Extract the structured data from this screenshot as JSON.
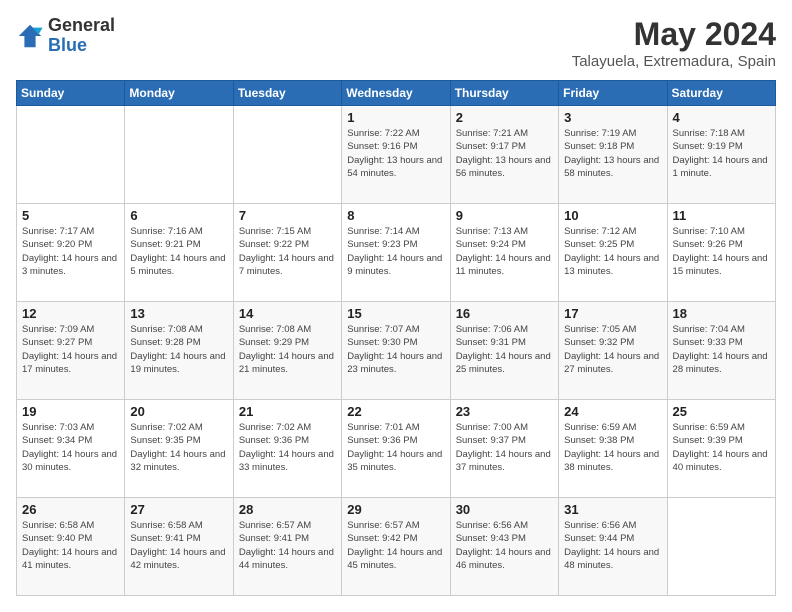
{
  "logo": {
    "general": "General",
    "blue": "Blue"
  },
  "header": {
    "title": "May 2024",
    "subtitle": "Talayuela, Extremadura, Spain"
  },
  "weekdays": [
    "Sunday",
    "Monday",
    "Tuesday",
    "Wednesday",
    "Thursday",
    "Friday",
    "Saturday"
  ],
  "weeks": [
    [
      {
        "day": "",
        "sunrise": "",
        "sunset": "",
        "daylight": ""
      },
      {
        "day": "",
        "sunrise": "",
        "sunset": "",
        "daylight": ""
      },
      {
        "day": "",
        "sunrise": "",
        "sunset": "",
        "daylight": ""
      },
      {
        "day": "1",
        "sunrise": "Sunrise: 7:22 AM",
        "sunset": "Sunset: 9:16 PM",
        "daylight": "Daylight: 13 hours and 54 minutes."
      },
      {
        "day": "2",
        "sunrise": "Sunrise: 7:21 AM",
        "sunset": "Sunset: 9:17 PM",
        "daylight": "Daylight: 13 hours and 56 minutes."
      },
      {
        "day": "3",
        "sunrise": "Sunrise: 7:19 AM",
        "sunset": "Sunset: 9:18 PM",
        "daylight": "Daylight: 13 hours and 58 minutes."
      },
      {
        "day": "4",
        "sunrise": "Sunrise: 7:18 AM",
        "sunset": "Sunset: 9:19 PM",
        "daylight": "Daylight: 14 hours and 1 minute."
      }
    ],
    [
      {
        "day": "5",
        "sunrise": "Sunrise: 7:17 AM",
        "sunset": "Sunset: 9:20 PM",
        "daylight": "Daylight: 14 hours and 3 minutes."
      },
      {
        "day": "6",
        "sunrise": "Sunrise: 7:16 AM",
        "sunset": "Sunset: 9:21 PM",
        "daylight": "Daylight: 14 hours and 5 minutes."
      },
      {
        "day": "7",
        "sunrise": "Sunrise: 7:15 AM",
        "sunset": "Sunset: 9:22 PM",
        "daylight": "Daylight: 14 hours and 7 minutes."
      },
      {
        "day": "8",
        "sunrise": "Sunrise: 7:14 AM",
        "sunset": "Sunset: 9:23 PM",
        "daylight": "Daylight: 14 hours and 9 minutes."
      },
      {
        "day": "9",
        "sunrise": "Sunrise: 7:13 AM",
        "sunset": "Sunset: 9:24 PM",
        "daylight": "Daylight: 14 hours and 11 minutes."
      },
      {
        "day": "10",
        "sunrise": "Sunrise: 7:12 AM",
        "sunset": "Sunset: 9:25 PM",
        "daylight": "Daylight: 14 hours and 13 minutes."
      },
      {
        "day": "11",
        "sunrise": "Sunrise: 7:10 AM",
        "sunset": "Sunset: 9:26 PM",
        "daylight": "Daylight: 14 hours and 15 minutes."
      }
    ],
    [
      {
        "day": "12",
        "sunrise": "Sunrise: 7:09 AM",
        "sunset": "Sunset: 9:27 PM",
        "daylight": "Daylight: 14 hours and 17 minutes."
      },
      {
        "day": "13",
        "sunrise": "Sunrise: 7:08 AM",
        "sunset": "Sunset: 9:28 PM",
        "daylight": "Daylight: 14 hours and 19 minutes."
      },
      {
        "day": "14",
        "sunrise": "Sunrise: 7:08 AM",
        "sunset": "Sunset: 9:29 PM",
        "daylight": "Daylight: 14 hours and 21 minutes."
      },
      {
        "day": "15",
        "sunrise": "Sunrise: 7:07 AM",
        "sunset": "Sunset: 9:30 PM",
        "daylight": "Daylight: 14 hours and 23 minutes."
      },
      {
        "day": "16",
        "sunrise": "Sunrise: 7:06 AM",
        "sunset": "Sunset: 9:31 PM",
        "daylight": "Daylight: 14 hours and 25 minutes."
      },
      {
        "day": "17",
        "sunrise": "Sunrise: 7:05 AM",
        "sunset": "Sunset: 9:32 PM",
        "daylight": "Daylight: 14 hours and 27 minutes."
      },
      {
        "day": "18",
        "sunrise": "Sunrise: 7:04 AM",
        "sunset": "Sunset: 9:33 PM",
        "daylight": "Daylight: 14 hours and 28 minutes."
      }
    ],
    [
      {
        "day": "19",
        "sunrise": "Sunrise: 7:03 AM",
        "sunset": "Sunset: 9:34 PM",
        "daylight": "Daylight: 14 hours and 30 minutes."
      },
      {
        "day": "20",
        "sunrise": "Sunrise: 7:02 AM",
        "sunset": "Sunset: 9:35 PM",
        "daylight": "Daylight: 14 hours and 32 minutes."
      },
      {
        "day": "21",
        "sunrise": "Sunrise: 7:02 AM",
        "sunset": "Sunset: 9:36 PM",
        "daylight": "Daylight: 14 hours and 33 minutes."
      },
      {
        "day": "22",
        "sunrise": "Sunrise: 7:01 AM",
        "sunset": "Sunset: 9:36 PM",
        "daylight": "Daylight: 14 hours and 35 minutes."
      },
      {
        "day": "23",
        "sunrise": "Sunrise: 7:00 AM",
        "sunset": "Sunset: 9:37 PM",
        "daylight": "Daylight: 14 hours and 37 minutes."
      },
      {
        "day": "24",
        "sunrise": "Sunrise: 6:59 AM",
        "sunset": "Sunset: 9:38 PM",
        "daylight": "Daylight: 14 hours and 38 minutes."
      },
      {
        "day": "25",
        "sunrise": "Sunrise: 6:59 AM",
        "sunset": "Sunset: 9:39 PM",
        "daylight": "Daylight: 14 hours and 40 minutes."
      }
    ],
    [
      {
        "day": "26",
        "sunrise": "Sunrise: 6:58 AM",
        "sunset": "Sunset: 9:40 PM",
        "daylight": "Daylight: 14 hours and 41 minutes."
      },
      {
        "day": "27",
        "sunrise": "Sunrise: 6:58 AM",
        "sunset": "Sunset: 9:41 PM",
        "daylight": "Daylight: 14 hours and 42 minutes."
      },
      {
        "day": "28",
        "sunrise": "Sunrise: 6:57 AM",
        "sunset": "Sunset: 9:41 PM",
        "daylight": "Daylight: 14 hours and 44 minutes."
      },
      {
        "day": "29",
        "sunrise": "Sunrise: 6:57 AM",
        "sunset": "Sunset: 9:42 PM",
        "daylight": "Daylight: 14 hours and 45 minutes."
      },
      {
        "day": "30",
        "sunrise": "Sunrise: 6:56 AM",
        "sunset": "Sunset: 9:43 PM",
        "daylight": "Daylight: 14 hours and 46 minutes."
      },
      {
        "day": "31",
        "sunrise": "Sunrise: 6:56 AM",
        "sunset": "Sunset: 9:44 PM",
        "daylight": "Daylight: 14 hours and 48 minutes."
      },
      {
        "day": "",
        "sunrise": "",
        "sunset": "",
        "daylight": ""
      }
    ]
  ]
}
